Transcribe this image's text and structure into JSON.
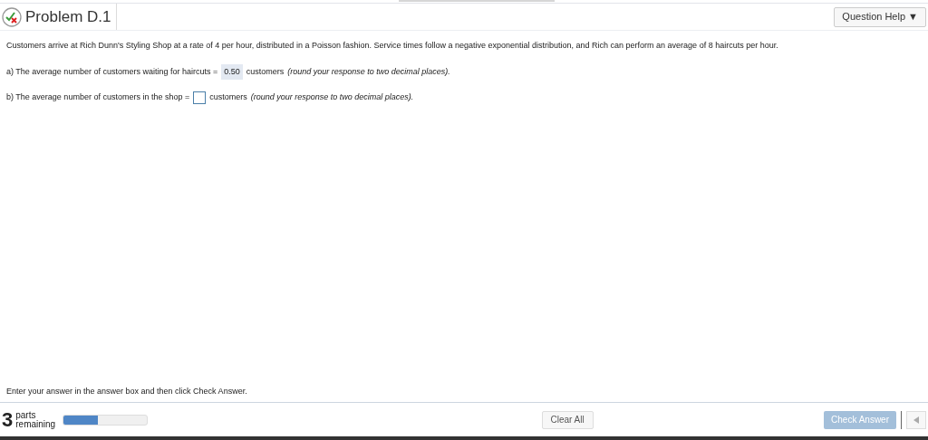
{
  "header": {
    "title": "Problem D.1",
    "help_button": "Question Help ▼"
  },
  "problem": {
    "statement": "Customers arrive at Rich Dunn's Styling Shop at a rate of 4 per hour, distributed in a Poisson fashion. Service times follow a negative exponential distribution, and Rich can perform an average of 8 haircuts per hour.",
    "parts": [
      {
        "prefix": "a) The average number of customers waiting for haircuts =",
        "answer": "0.50",
        "suffix": "customers",
        "note": "(round your response to two decimal places)."
      },
      {
        "prefix": "b) The average number of customers in the shop =",
        "suffix": "customers",
        "note": "(round your response to two decimal places)."
      }
    ]
  },
  "instruction": "Enter your answer in the answer box and then click Check Answer.",
  "footer": {
    "parts_count": "3",
    "parts_label_1": "parts",
    "parts_label_2": "remaining",
    "progress": {
      "level": 0.41
    },
    "clear_button": "Clear All",
    "check_button": {
      "label": "Check Answer",
      "disabled": true
    }
  }
}
